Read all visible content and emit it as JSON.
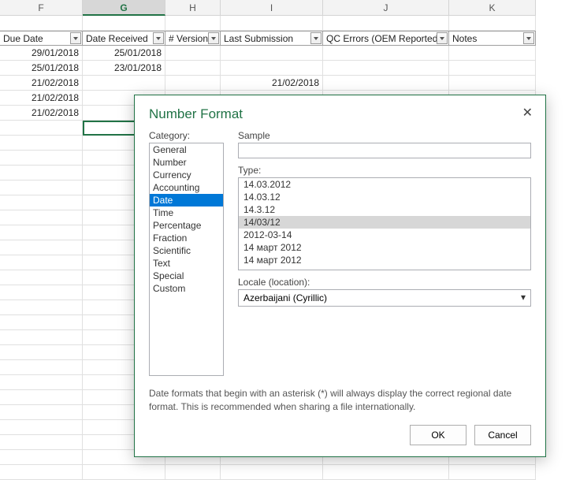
{
  "columns": [
    {
      "letter": "F",
      "width": 105,
      "label": "Due Date"
    },
    {
      "letter": "G",
      "width": 105,
      "label": "Date Received",
      "selected": true
    },
    {
      "letter": "H",
      "width": 70,
      "label": "# Versions"
    },
    {
      "letter": "I",
      "width": 130,
      "label": "Last Submission"
    },
    {
      "letter": "J",
      "width": 160,
      "label": "QC Errors (OEM Reported)"
    },
    {
      "letter": "K",
      "width": 110,
      "label": "Notes"
    }
  ],
  "rows": [
    {
      "F": "29/01/2018",
      "G": "25/01/2018"
    },
    {
      "F": "25/01/2018",
      "G": "23/01/2018"
    },
    {
      "F": "21/02/2018",
      "I": "21/02/2018"
    },
    {
      "F": "21/02/2018"
    },
    {
      "F": "21/02/2018"
    }
  ],
  "selected_cell": "G8",
  "dialog": {
    "title": "Number Format",
    "category_label": "Category:",
    "sample_label": "Sample",
    "type_label": "Type:",
    "locale_label": "Locale (location):",
    "categories": [
      "General",
      "Number",
      "Currency",
      "Accounting",
      "Date",
      "Time",
      "Percentage",
      "Fraction",
      "Scientific",
      "Text",
      "Special",
      "Custom"
    ],
    "selected_category": "Date",
    "types": [
      "14.03.2012",
      "14.03.12",
      "14.3.12",
      "14/03/12",
      "2012-03-14",
      "14 март 2012",
      "14 март 2012"
    ],
    "selected_type": "14/03/12",
    "locale": "Azerbaijani (Cyrillic)",
    "help": "Date formats that begin with an asterisk (*) will always display the correct regional date format. This is recommended when sharing a file internationally.",
    "ok": "OK",
    "cancel": "Cancel"
  }
}
